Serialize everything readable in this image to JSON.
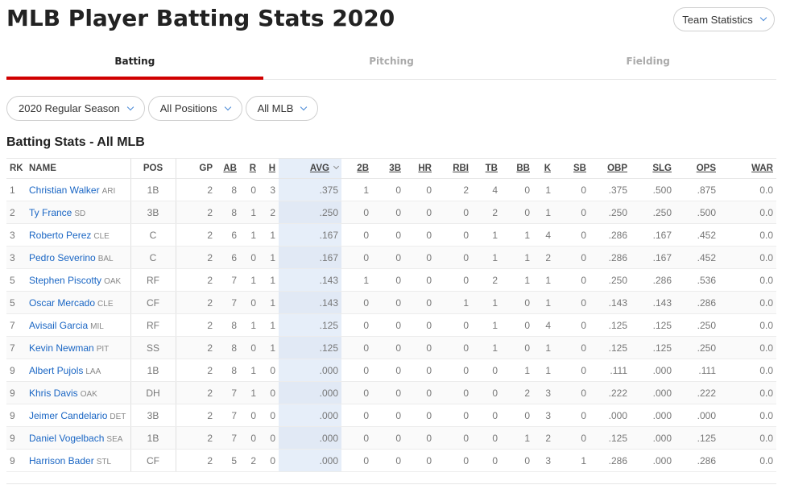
{
  "page": {
    "title": "MLB Player Batting Stats 2020",
    "team_stats_label": "Team Statistics"
  },
  "tabs": [
    {
      "label": "Batting",
      "active": true
    },
    {
      "label": "Pitching",
      "active": false
    },
    {
      "label": "Fielding",
      "active": false
    }
  ],
  "filters": [
    {
      "label": "2020 Regular Season"
    },
    {
      "label": "All Positions"
    },
    {
      "label": "All MLB"
    }
  ],
  "section_title": "Batting Stats - All MLB",
  "colors": {
    "accent": "#d00000",
    "link": "#1a66c4",
    "sorted_col": "#e6eef9"
  },
  "table": {
    "columns": [
      "RK",
      "NAME",
      "POS",
      "GP",
      "AB",
      "R",
      "H",
      "AVG",
      "2B",
      "3B",
      "HR",
      "RBI",
      "TB",
      "BB",
      "K",
      "SB",
      "OBP",
      "SLG",
      "OPS",
      "WAR"
    ],
    "sorted_column": "AVG",
    "rows": [
      {
        "rk": "1",
        "name": "Christian Walker",
        "team": "ARI",
        "pos": "1B",
        "gp": "2",
        "ab": "8",
        "r": "0",
        "h": "3",
        "avg": ".375",
        "b2": "1",
        "b3": "0",
        "hr": "0",
        "rbi": "2",
        "tb": "4",
        "bb": "0",
        "k": "1",
        "sb": "0",
        "obp": ".375",
        "slg": ".500",
        "ops": ".875",
        "war": "0.0"
      },
      {
        "rk": "2",
        "name": "Ty France",
        "team": "SD",
        "pos": "3B",
        "gp": "2",
        "ab": "8",
        "r": "1",
        "h": "2",
        "avg": ".250",
        "b2": "0",
        "b3": "0",
        "hr": "0",
        "rbi": "0",
        "tb": "2",
        "bb": "0",
        "k": "1",
        "sb": "0",
        "obp": ".250",
        "slg": ".250",
        "ops": ".500",
        "war": "0.0"
      },
      {
        "rk": "3",
        "name": "Roberto Perez",
        "team": "CLE",
        "pos": "C",
        "gp": "2",
        "ab": "6",
        "r": "1",
        "h": "1",
        "avg": ".167",
        "b2": "0",
        "b3": "0",
        "hr": "0",
        "rbi": "0",
        "tb": "1",
        "bb": "1",
        "k": "4",
        "sb": "0",
        "obp": ".286",
        "slg": ".167",
        "ops": ".452",
        "war": "0.0"
      },
      {
        "rk": "3",
        "name": "Pedro Severino",
        "team": "BAL",
        "pos": "C",
        "gp": "2",
        "ab": "6",
        "r": "0",
        "h": "1",
        "avg": ".167",
        "b2": "0",
        "b3": "0",
        "hr": "0",
        "rbi": "0",
        "tb": "1",
        "bb": "1",
        "k": "2",
        "sb": "0",
        "obp": ".286",
        "slg": ".167",
        "ops": ".452",
        "war": "0.0"
      },
      {
        "rk": "5",
        "name": "Stephen Piscotty",
        "team": "OAK",
        "pos": "RF",
        "gp": "2",
        "ab": "7",
        "r": "1",
        "h": "1",
        "avg": ".143",
        "b2": "1",
        "b3": "0",
        "hr": "0",
        "rbi": "0",
        "tb": "2",
        "bb": "1",
        "k": "1",
        "sb": "0",
        "obp": ".250",
        "slg": ".286",
        "ops": ".536",
        "war": "0.0"
      },
      {
        "rk": "5",
        "name": "Oscar Mercado",
        "team": "CLE",
        "pos": "CF",
        "gp": "2",
        "ab": "7",
        "r": "0",
        "h": "1",
        "avg": ".143",
        "b2": "0",
        "b3": "0",
        "hr": "0",
        "rbi": "1",
        "tb": "1",
        "bb": "0",
        "k": "1",
        "sb": "0",
        "obp": ".143",
        "slg": ".143",
        "ops": ".286",
        "war": "0.0"
      },
      {
        "rk": "7",
        "name": "Avisail Garcia",
        "team": "MIL",
        "pos": "RF",
        "gp": "2",
        "ab": "8",
        "r": "1",
        "h": "1",
        "avg": ".125",
        "b2": "0",
        "b3": "0",
        "hr": "0",
        "rbi": "0",
        "tb": "1",
        "bb": "0",
        "k": "4",
        "sb": "0",
        "obp": ".125",
        "slg": ".125",
        "ops": ".250",
        "war": "0.0"
      },
      {
        "rk": "7",
        "name": "Kevin Newman",
        "team": "PIT",
        "pos": "SS",
        "gp": "2",
        "ab": "8",
        "r": "0",
        "h": "1",
        "avg": ".125",
        "b2": "0",
        "b3": "0",
        "hr": "0",
        "rbi": "0",
        "tb": "1",
        "bb": "0",
        "k": "1",
        "sb": "0",
        "obp": ".125",
        "slg": ".125",
        "ops": ".250",
        "war": "0.0"
      },
      {
        "rk": "9",
        "name": "Albert Pujols",
        "team": "LAA",
        "pos": "1B",
        "gp": "2",
        "ab": "8",
        "r": "1",
        "h": "0",
        "avg": ".000",
        "b2": "0",
        "b3": "0",
        "hr": "0",
        "rbi": "0",
        "tb": "0",
        "bb": "1",
        "k": "1",
        "sb": "0",
        "obp": ".111",
        "slg": ".000",
        "ops": ".111",
        "war": "0.0"
      },
      {
        "rk": "9",
        "name": "Khris Davis",
        "team": "OAK",
        "pos": "DH",
        "gp": "2",
        "ab": "7",
        "r": "1",
        "h": "0",
        "avg": ".000",
        "b2": "0",
        "b3": "0",
        "hr": "0",
        "rbi": "0",
        "tb": "0",
        "bb": "2",
        "k": "3",
        "sb": "0",
        "obp": ".222",
        "slg": ".000",
        "ops": ".222",
        "war": "0.0"
      },
      {
        "rk": "9",
        "name": "Jeimer Candelario",
        "team": "DET",
        "pos": "3B",
        "gp": "2",
        "ab": "7",
        "r": "0",
        "h": "0",
        "avg": ".000",
        "b2": "0",
        "b3": "0",
        "hr": "0",
        "rbi": "0",
        "tb": "0",
        "bb": "0",
        "k": "3",
        "sb": "0",
        "obp": ".000",
        "slg": ".000",
        "ops": ".000",
        "war": "0.0"
      },
      {
        "rk": "9",
        "name": "Daniel Vogelbach",
        "team": "SEA",
        "pos": "1B",
        "gp": "2",
        "ab": "7",
        "r": "0",
        "h": "0",
        "avg": ".000",
        "b2": "0",
        "b3": "0",
        "hr": "0",
        "rbi": "0",
        "tb": "0",
        "bb": "1",
        "k": "2",
        "sb": "0",
        "obp": ".125",
        "slg": ".000",
        "ops": ".125",
        "war": "0.0"
      },
      {
        "rk": "9",
        "name": "Harrison Bader",
        "team": "STL",
        "pos": "CF",
        "gp": "2",
        "ab": "5",
        "r": "2",
        "h": "0",
        "avg": ".000",
        "b2": "0",
        "b3": "0",
        "hr": "0",
        "rbi": "0",
        "tb": "0",
        "bb": "0",
        "k": "3",
        "sb": "1",
        "obp": ".286",
        "slg": ".000",
        "ops": ".286",
        "war": "0.0"
      }
    ]
  }
}
